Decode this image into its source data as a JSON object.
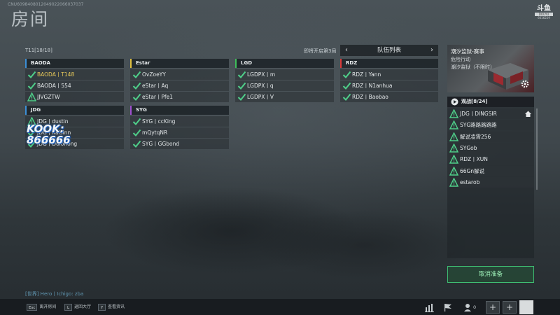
{
  "header": {
    "session_id": "CNU6098408012049022066037037",
    "room_title": "房间",
    "corner_logo": {
      "line1": "斗鱼",
      "line2": "DOUYU",
      "line3": "6616229"
    }
  },
  "match": {
    "round_label": "T11[18/18]",
    "upcoming": "即将开启第3局"
  },
  "teams": [
    {
      "name": "BAODA",
      "color": "#3d8fd6",
      "players": [
        {
          "name": "BAODA丨T148",
          "status": "check",
          "highlight": true
        },
        {
          "name": "BAODA丨554",
          "status": "check"
        },
        {
          "name": "JJVGZTW",
          "status": "warn"
        }
      ]
    },
    {
      "name": "Estar",
      "color": "#e0c040",
      "players": [
        {
          "name": "OvZoeYY",
          "status": "check"
        },
        {
          "name": "eStar丨Aq",
          "status": "check"
        },
        {
          "name": "eStar丨Pfe1",
          "status": "check"
        }
      ]
    },
    {
      "name": "LGD",
      "color": "#3fbf5a",
      "players": [
        {
          "name": "LGDPX丨m",
          "status": "check"
        },
        {
          "name": "LGDPX丨q",
          "status": "check"
        },
        {
          "name": "LGDPX丨V",
          "status": "check"
        }
      ]
    },
    {
      "name": "RDZ",
      "color": "#d93a3a",
      "players": [
        {
          "name": "RDZ丨Yann",
          "status": "check"
        },
        {
          "name": "RDZ丨N1anhua",
          "status": "check"
        },
        {
          "name": "RDZ丨Baobao",
          "status": "check"
        }
      ]
    },
    {
      "name": "JDG",
      "color": "#3d8fd6",
      "players": [
        {
          "name": "JDG丨dustin",
          "status": "warn"
        },
        {
          "name": "JDG丨Kaisinn",
          "status": "check"
        },
        {
          "name": "JDG丨Dolonong",
          "status": "check"
        }
      ]
    },
    {
      "name": "SYG",
      "color": "#a050d0",
      "players": [
        {
          "name": "SYG丨ccKing",
          "status": "check"
        },
        {
          "name": "mQytqNR",
          "status": "check"
        },
        {
          "name": "SYG丨GGbond",
          "status": "check"
        }
      ]
    }
  ],
  "team_list": {
    "title": "队伍列表",
    "prev_icon": "chevron-left-icon",
    "next_icon": "chevron-right-icon"
  },
  "event_card": {
    "title": "潮汐监狱-赛事",
    "line2": "危险行动",
    "line3": "潮汐监狱（不限时）"
  },
  "spectators": {
    "header": "观战[8/24]",
    "items": [
      {
        "name": "JDG丨DINGSIR",
        "owner": true
      },
      {
        "name": "SYG路路路路路"
      },
      {
        "name": "解说凌霄256"
      },
      {
        "name": "SYGob"
      },
      {
        "name": "RDZ丨XUN"
      },
      {
        "name": "66Gn解说"
      },
      {
        "name": "estarob"
      }
    ]
  },
  "actions": {
    "cancel_ready": "取消准备"
  },
  "chat": {
    "last_line": "[世界] Hero丨Ichigo: zba"
  },
  "bottom_hints": [
    {
      "key": "Esc",
      "label": "离开房间"
    },
    {
      "key": "L",
      "label": "返回大厅"
    },
    {
      "key": "Y",
      "label": "查看资讯"
    }
  ],
  "bottom_count": "0",
  "watermark": {
    "line1": "KOOK:",
    "line2": "866666"
  },
  "colors": {
    "accent_green": "#3fbf73",
    "check_green": "#4fd08a",
    "warn_green": "#4fd08a",
    "highlight_name": "#e6c85a"
  }
}
